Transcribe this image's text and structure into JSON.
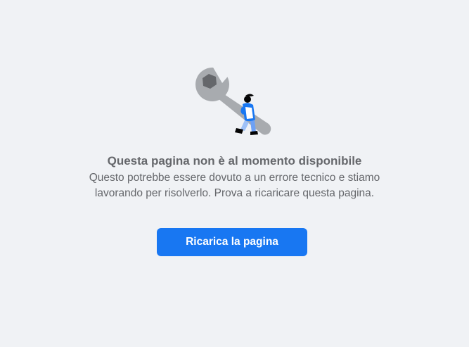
{
  "error": {
    "illustration_icon": "wrench-worker-icon",
    "title": "Questa pagina non è al momento disponibile",
    "message": "Questo potrebbe essere dovuto a un errore tecnico e stiamo lavorando per risolverlo. Prova a ricaricare questa pagina.",
    "reload_label": "Ricarica la pagina"
  },
  "colors": {
    "background": "#f0f2f5",
    "text": "#65676b",
    "button": "#1877f2",
    "button_text": "#ffffff",
    "wrench": "#a8abaf"
  }
}
